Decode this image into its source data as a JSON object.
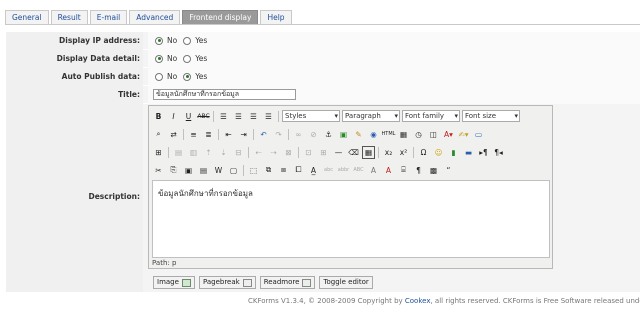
{
  "tabs": [
    "General",
    "Result",
    "E-mail",
    "Advanced",
    "Frontend display",
    "Help"
  ],
  "fields": {
    "ip": {
      "label": "Display IP address:",
      "opt1": "No",
      "opt2": "Yes"
    },
    "detail": {
      "label": "Display Data detail:",
      "opt1": "No",
      "opt2": "Yes"
    },
    "auto": {
      "label": "Auto Publish data:",
      "opt1": "No",
      "opt2": "Yes"
    },
    "title": {
      "label": "Title:",
      "value": "ข้อมูลนักศึกษาที่กรอกข้อมูล"
    },
    "desc": {
      "label": "Description:"
    }
  },
  "editor": {
    "styles": "Styles",
    "paragraph": "Paragraph",
    "fontfamily": "Font family",
    "fontsize": "Font size",
    "content": "ข้อมูลนักศึกษาที่กรอกข้อมูล",
    "path": "Path: p"
  },
  "buttons": {
    "image": "Image",
    "pagebreak": "Pagebreak",
    "readmore": "Readmore",
    "toggle": "Toggle editor"
  },
  "footer": {
    "pre": "CKForms V1.3.4, © 2008-2009 Copyright by ",
    "link": "Cookex",
    "post": ", all rights reserved. CKForms is Free Software released under the G"
  }
}
